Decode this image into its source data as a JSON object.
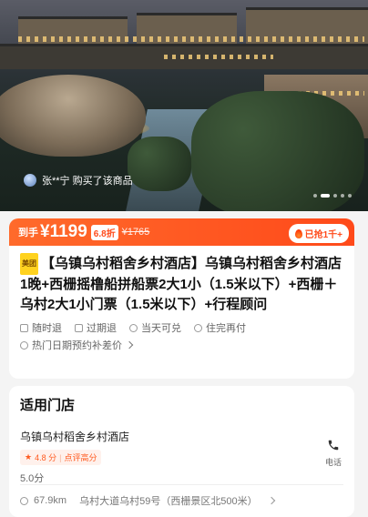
{
  "hero": {
    "buyer_text": "张**宁 购买了该商品",
    "carousel": {
      "total": 5,
      "active": 1
    }
  },
  "price": {
    "label": "到手",
    "amount": "¥1199",
    "discount": "6.8折",
    "original": "¥1765",
    "sold": "已抢1千+"
  },
  "product": {
    "tag": "美团",
    "title": "【乌镇乌村稻舍乡村酒店】乌镇乌村稻舍乡村酒店1晚+西栅摇橹船拼船票2大1小（1.5米以下）+西栅＋乌村2大1小门票（1.5米以下）+行程顾问",
    "features": [
      "随时退",
      "过期退",
      "当天可兑",
      "住完再付"
    ],
    "promo": "热门日期预约补差价"
  },
  "store": {
    "heading": "适用门店",
    "name": "乌镇乌村稻舍乡村酒店",
    "score": "4.8 分",
    "review_label": "点评高分",
    "rating_text": "5.0分",
    "phone_label": "电话",
    "distance": "67.9km",
    "address": "乌村大道乌村59号（西栅景区北500米）"
  },
  "colors": {
    "accent": "#ff4a1a",
    "tag": "#ffd21f"
  }
}
